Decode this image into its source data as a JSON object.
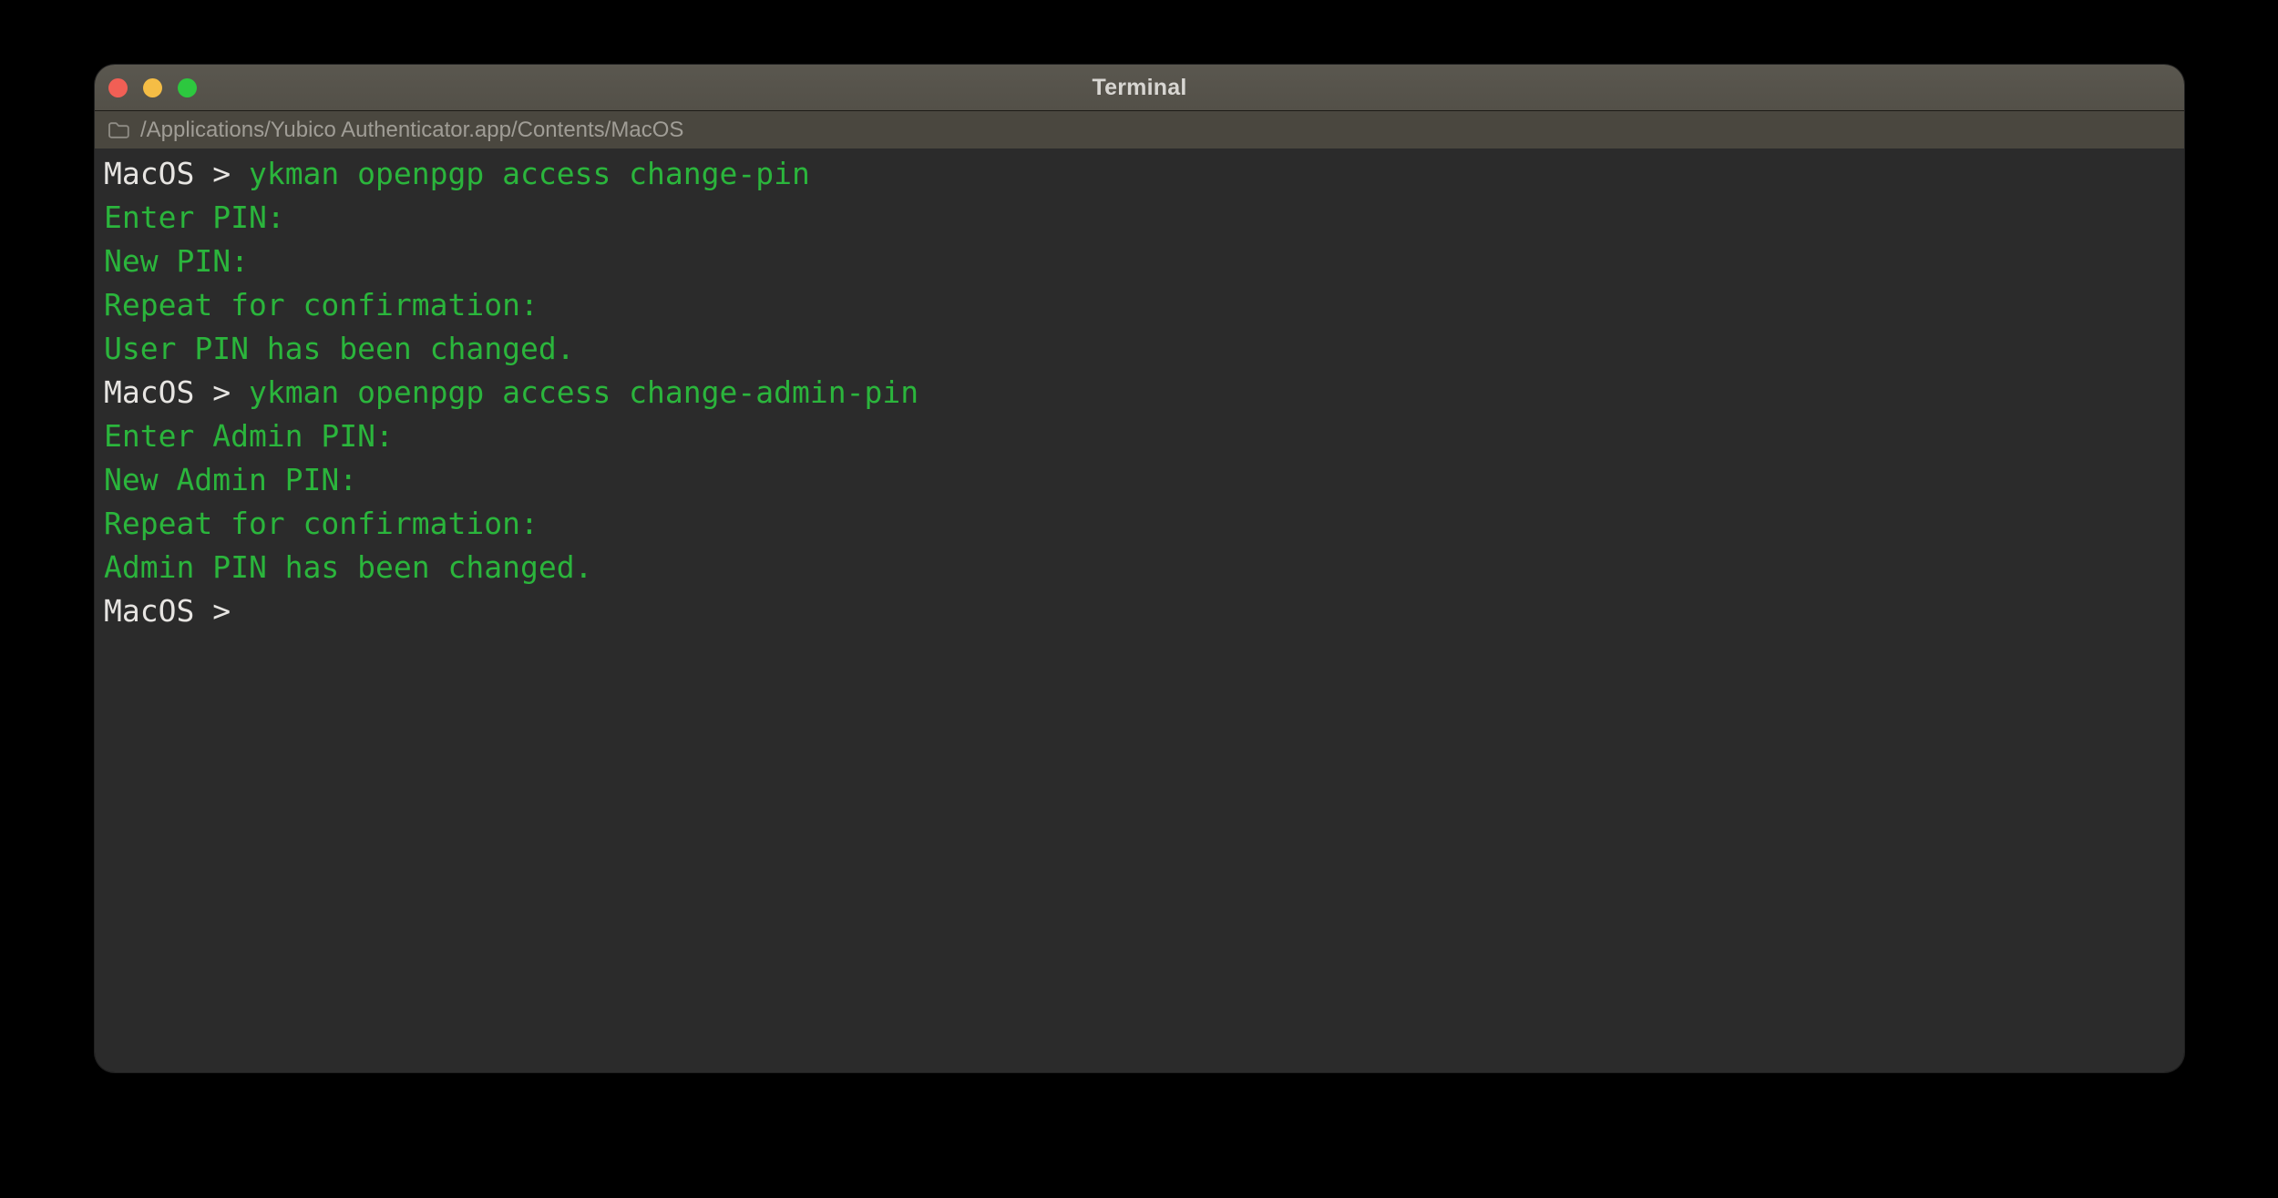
{
  "theme": {
    "titlebar-bg": "#55524a",
    "pathbar-bg": "#4a473f",
    "term-bg": "#2b2b2b",
    "term-fg": "#e7e5e2",
    "term-green": "#2bb53c",
    "light-red": "#f15f55",
    "light-yellow": "#f5bd45",
    "light-green": "#2dc83f"
  },
  "window": {
    "title": "Terminal"
  },
  "tab_bar": {
    "path": "/Applications/Yubico Authenticator.app/Contents/MacOS",
    "folder_icon": "folder-icon"
  },
  "terminal": {
    "prompt": "MacOS >",
    "lines": [
      {
        "segments": [
          {
            "text": "MacOS > ",
            "color": "prompt"
          },
          {
            "text": "ykman openpgp access change-pin",
            "color": "green"
          }
        ]
      },
      {
        "segments": [
          {
            "text": "Enter PIN:",
            "color": "green"
          }
        ]
      },
      {
        "segments": [
          {
            "text": "New PIN:",
            "color": "green"
          }
        ]
      },
      {
        "segments": [
          {
            "text": "Repeat for confirmation:",
            "color": "green"
          }
        ]
      },
      {
        "segments": [
          {
            "text": "User PIN has been changed.",
            "color": "green"
          }
        ]
      },
      {
        "segments": [
          {
            "text": "MacOS > ",
            "color": "prompt"
          },
          {
            "text": "ykman openpgp access change-admin-pin",
            "color": "green"
          }
        ]
      },
      {
        "segments": [
          {
            "text": "Enter Admin PIN:",
            "color": "green"
          }
        ]
      },
      {
        "segments": [
          {
            "text": "New Admin PIN:",
            "color": "green"
          }
        ]
      },
      {
        "segments": [
          {
            "text": "Repeat for confirmation:",
            "color": "green"
          }
        ]
      },
      {
        "segments": [
          {
            "text": "Admin PIN has been changed.",
            "color": "green"
          }
        ]
      },
      {
        "segments": [
          {
            "text": "MacOS >",
            "color": "prompt"
          }
        ]
      }
    ]
  }
}
